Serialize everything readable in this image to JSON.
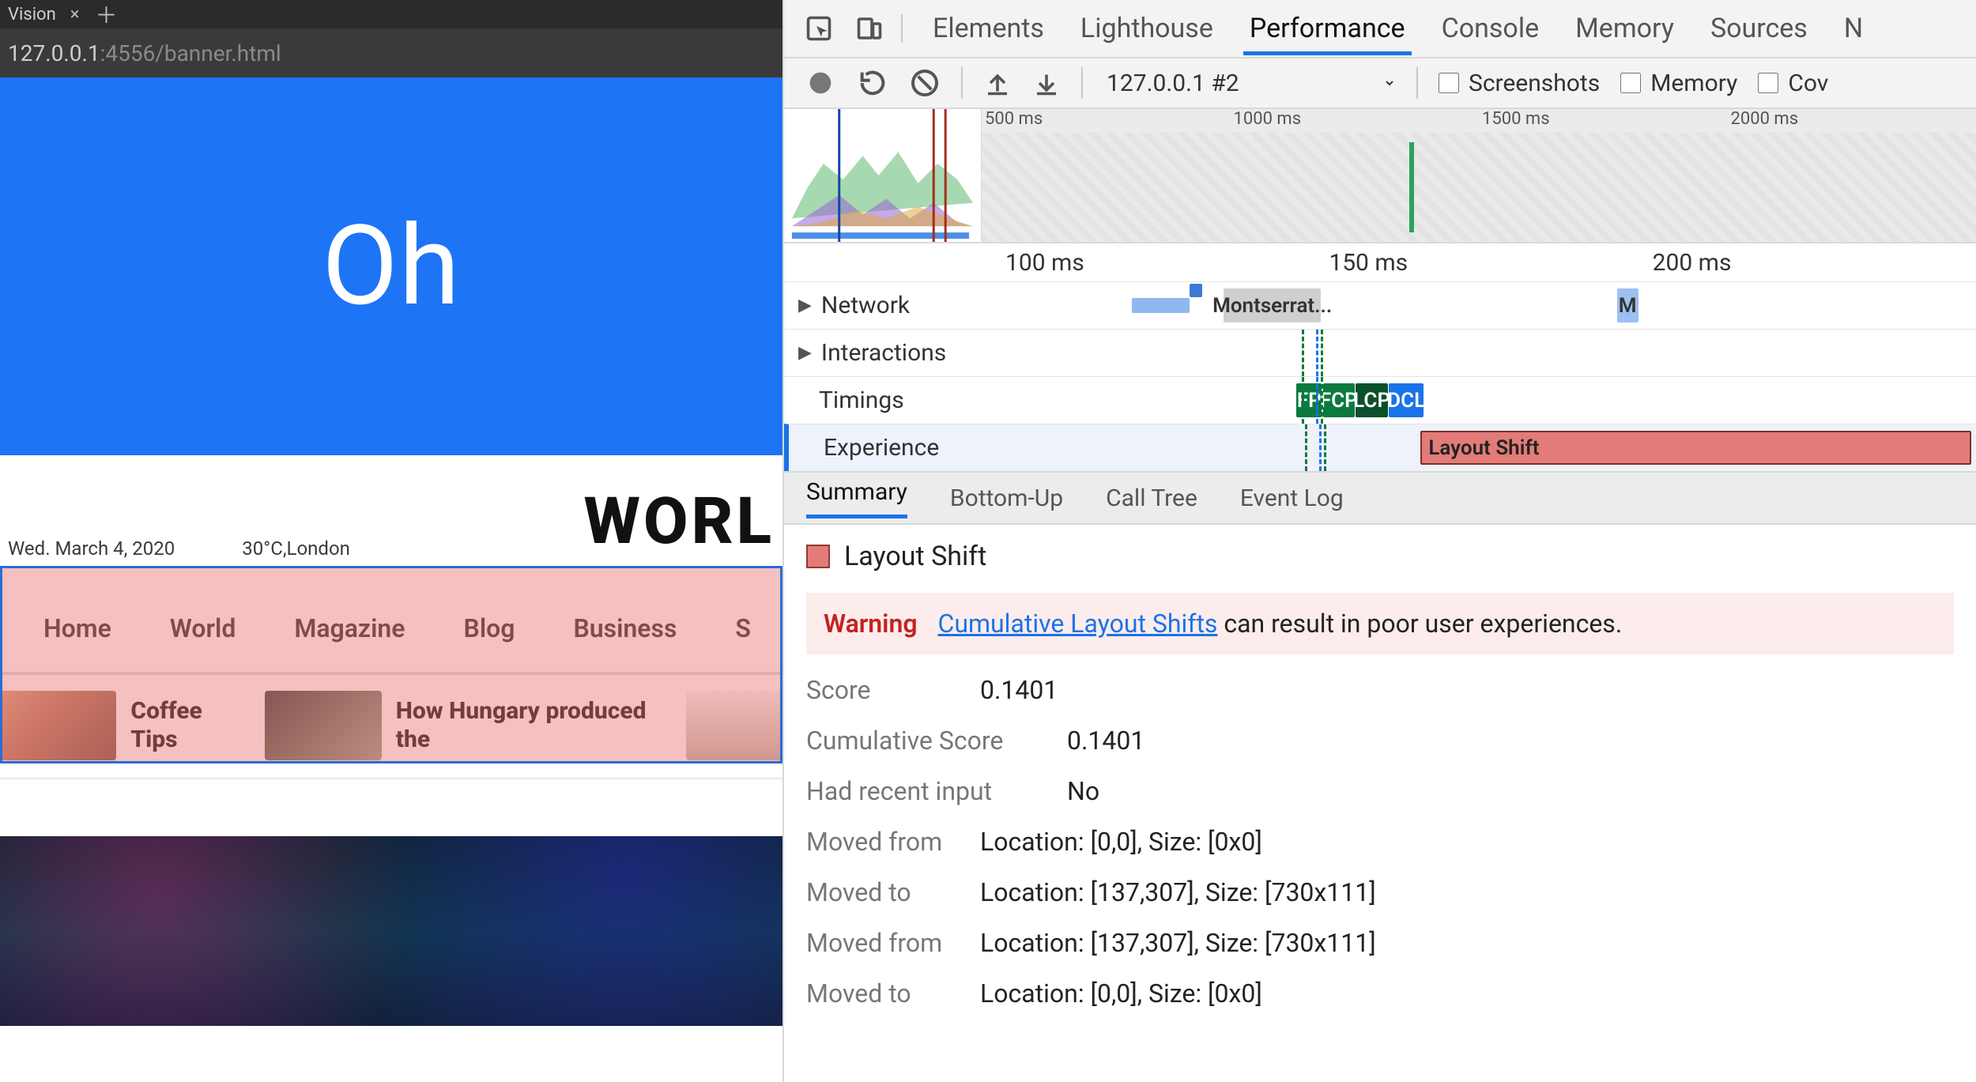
{
  "browser": {
    "tab_title": "Vision",
    "url_host": "127.0.0.1",
    "url_rest": ":4556/banner.html",
    "hero_text": "Oh",
    "date": "Wed. March 4, 2020",
    "weather": "30°C,London",
    "site_title": "WORL",
    "nav": [
      "Home",
      "World",
      "Magazine",
      "Blog",
      "Business",
      "S"
    ],
    "cards": [
      {
        "title": "Coffee Tips"
      },
      {
        "title": "How Hungary produced the"
      }
    ]
  },
  "devtools": {
    "panels": [
      "Elements",
      "Lighthouse",
      "Performance",
      "Console",
      "Memory",
      "Sources",
      "N"
    ],
    "active_panel": "Performance",
    "toolbar": {
      "session": "127.0.0.1 #2",
      "checkboxes": [
        "Screenshots",
        "Memory",
        "Cov"
      ]
    },
    "overview_ticks": [
      "500 ms",
      "1000 ms",
      "1500 ms",
      "2000 ms"
    ],
    "track_ticks": [
      "100 ms",
      "150 ms",
      "200 ms"
    ],
    "tracks": {
      "network": {
        "label": "Network",
        "resource": "Montserrat...",
        "tail": "M"
      },
      "interactions": {
        "label": "Interactions"
      },
      "timings": {
        "label": "Timings",
        "marks": [
          "FP",
          "FCP",
          "LCP",
          "DCL"
        ]
      },
      "experience": {
        "label": "Experience",
        "event": "Layout Shift"
      }
    },
    "detail_tabs": [
      "Summary",
      "Bottom-Up",
      "Call Tree",
      "Event Log"
    ],
    "active_detail": "Summary",
    "detail_title": "Layout Shift",
    "warning": {
      "label": "Warning",
      "link": "Cumulative Layout Shifts",
      "rest": " can result in poor user experiences."
    },
    "rows": [
      {
        "k": "Score",
        "v": "0.1401",
        "short": true
      },
      {
        "k": "Cumulative Score",
        "v": "0.1401"
      },
      {
        "k": "Had recent input",
        "v": "No"
      },
      {
        "k": "Moved from",
        "v": "Location: [0,0], Size: [0x0]",
        "short": true
      },
      {
        "k": "Moved to",
        "v": "Location: [137,307], Size: [730x111]",
        "short": true
      },
      {
        "k": "Moved from",
        "v": "Location: [137,307], Size: [730x111]",
        "short": true
      },
      {
        "k": "Moved to",
        "v": "Location: [0,0], Size: [0x0]",
        "short": true
      }
    ]
  }
}
